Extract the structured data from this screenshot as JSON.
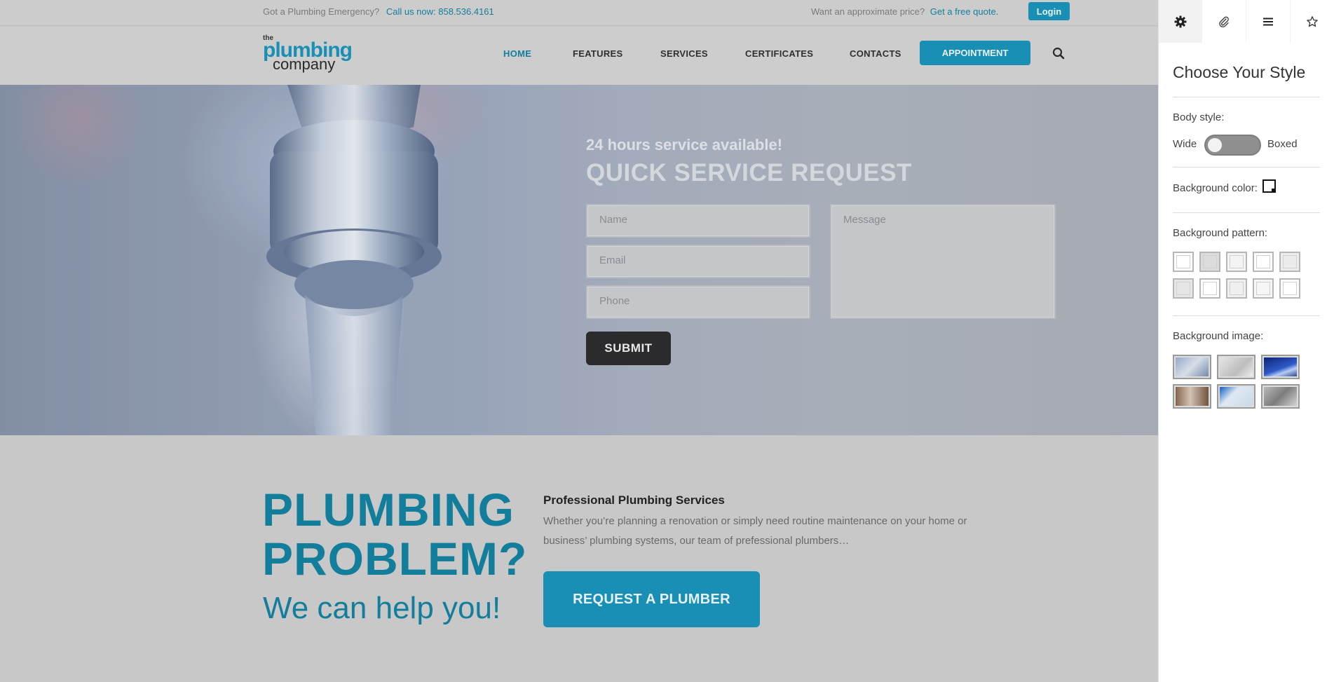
{
  "topbar": {
    "emergency_text": "Got a Plumbing Emergency?",
    "phone_text": "Call us now: 858.536.4161",
    "price_text": "Want an approximate price?",
    "quote_link": "Get a free quote.",
    "login_label": "Login"
  },
  "header": {
    "logo": {
      "the": "the",
      "plumbing": "plumbing",
      "company": "company"
    },
    "nav": [
      "HOME",
      "FEATURES",
      "SERVICES",
      "CERTIFICATES",
      "CONTACTS"
    ],
    "active_nav": "HOME",
    "appointment_label": "APPOINTMENT",
    "search_icon": "search-icon"
  },
  "hero": {
    "tagline": "24 hours service available!",
    "title": "QUICK SERVICE REQUEST",
    "form": {
      "name_placeholder": "Name",
      "email_placeholder": "Email",
      "phone_placeholder": "Phone",
      "message_placeholder": "Message",
      "submit_label": "SUBMIT"
    }
  },
  "promo": {
    "headline_line1": "PLUMBING",
    "headline_line2": "PROBLEM?",
    "subheadline": "We can help you!",
    "service_title": "Professional Plumbing Services",
    "service_text": "Whether you’re planning a renovation or simply need routine maintenance on your home or business’ plumbing systems, our team of prefessional plumbers…",
    "cta_label": "REQUEST A PLUMBER"
  },
  "style_panel": {
    "tabs": [
      "gear-icon",
      "paperclip-icon",
      "menu-icon",
      "star-icon"
    ],
    "title": "Choose Your Style",
    "body_style_label": "Body style:",
    "wide_label": "Wide",
    "boxed_label": "Boxed",
    "body_style_value": "Wide",
    "background_color_label": "Background color:",
    "background_pattern_label": "Background pattern:",
    "background_image_label": "Background image:"
  },
  "colors": {
    "accent": "#1a8fb5",
    "accent_dark": "#137e9c",
    "submit": "#2b2b2e"
  }
}
